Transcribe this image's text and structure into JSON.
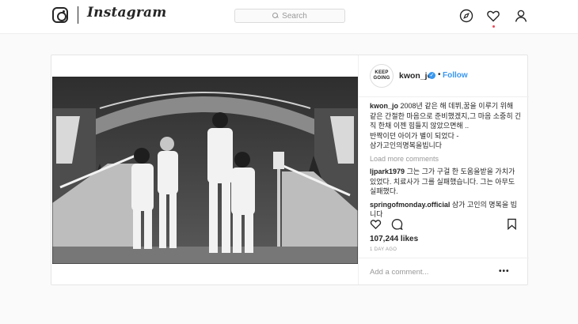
{
  "header": {
    "wordmark": "Instagram",
    "search_placeholder": "Search",
    "icons": [
      "instagram-logo-icon",
      "compass-icon",
      "heart-icon",
      "user-icon"
    ]
  },
  "post": {
    "author": {
      "avatar_text_1": "KEEP",
      "avatar_text_2": "GOING",
      "username": "kwon_jo",
      "verified": true,
      "separator": "•",
      "follow_label": "Follow"
    },
    "caption": {
      "username": "kwon_jo",
      "lines": [
        "2008년 같은 해 데뷔,꿈을 이루기 위해",
        "같은 간절한 마음으로 준비했겠지,그 마음 소중히 간",
        "직 한채 이젠 힘들지 않았으면해 ..",
        "반짝이던 아이가 별이 되었다 -",
        "삼가고인의명복을빕니다"
      ]
    },
    "load_more_label": "Load more comments",
    "comments": [
      {
        "user": "ljpark1979",
        "text": "그는 그가 구걸 한 도움을받을 가치가 있었다. 치료사가 그를 실패했습니다. 그는 아무도 실패했다."
      },
      {
        "user": "springofmonday.official",
        "text": "삼가 고인의 명복을 빕니다"
      }
    ],
    "likes": "107,244 likes",
    "time_ago": "1 DAY AGO",
    "add_comment_placeholder": "Add a comment...",
    "more_label": "•••"
  },
  "colors": {
    "accent": "#3897f0",
    "notification": "#ed4956",
    "border": "#e6e6e6",
    "muted_text": "#999999"
  }
}
